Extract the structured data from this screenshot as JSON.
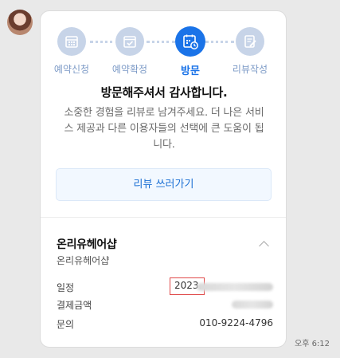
{
  "steps": [
    {
      "label": "예약신청",
      "icon": "calendar-grid-icon",
      "active": false
    },
    {
      "label": "예약확정",
      "icon": "calendar-check-icon",
      "active": false
    },
    {
      "label": "방문",
      "icon": "calendar-clock-icon",
      "active": true
    },
    {
      "label": "리뷰작성",
      "icon": "pencil-doc-icon",
      "active": false
    }
  ],
  "message": {
    "title": "방문해주셔서 감사합니다.",
    "description": "소중한 경험을 리뷰로 남겨주세요. 더 나은 서비스 제공과 다른 이용자들의 선택에 큰 도움이 됩니다."
  },
  "review_button": {
    "label": "리뷰 쓰러가기"
  },
  "shop": {
    "name": "온리유헤어샵",
    "sub": "온리유헤어샵"
  },
  "info": {
    "schedule_label": "일정",
    "schedule_value": "2023.",
    "payment_label": "결제금액",
    "contact_label": "문의",
    "contact_value": "010-9224-4796"
  },
  "timestamp": "오후 6:12",
  "colors": {
    "accent": "#1a73e8",
    "inactive_step": "#c7d4e8",
    "highlight_box": "#e04a4a"
  }
}
